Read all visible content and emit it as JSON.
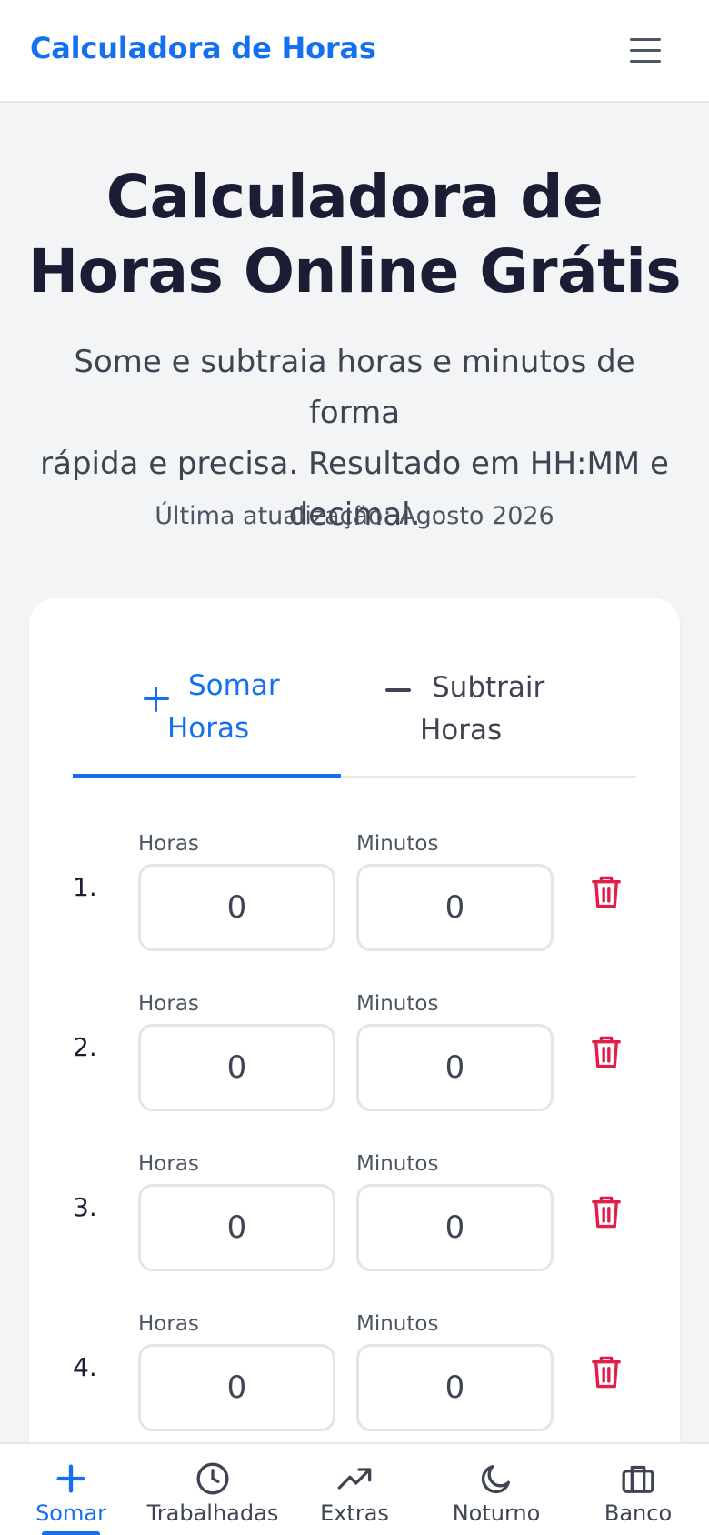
{
  "header": {
    "brand": "Calculadora de Horas",
    "menu_icon": "hamburger-menu-icon"
  },
  "hero": {
    "title_line1": "Calculadora de",
    "title_line2": "Horas Online Grátis",
    "subtitle_line1": "Some e subtraia horas e minutos de forma",
    "subtitle_line2": "rápida e precisa. Resultado em HH:MM e",
    "subtitle_line3": "decimal.",
    "updated": "Última atualização: Agosto 2026"
  },
  "tabs": {
    "add": {
      "line1": "Somar",
      "line2": "Horas",
      "icon": "plus-icon",
      "active": true
    },
    "subtract": {
      "line1": "Subtrair",
      "line2": "Horas",
      "icon": "minus-icon",
      "active": false
    }
  },
  "rows": [
    {
      "num": "1.",
      "hours_label": "Horas",
      "minutes_label": "Minutos",
      "hours": "0",
      "minutes": "0"
    },
    {
      "num": "2.",
      "hours_label": "Horas",
      "minutes_label": "Minutos",
      "hours": "0",
      "minutes": "0"
    },
    {
      "num": "3.",
      "hours_label": "Horas",
      "minutes_label": "Minutos",
      "hours": "0",
      "minutes": "0"
    },
    {
      "num": "4.",
      "hours_label": "Horas",
      "minutes_label": "Minutos",
      "hours": "0",
      "minutes": "0"
    }
  ],
  "bottom_nav": [
    {
      "label": "Somar",
      "icon": "plus-icon",
      "active": true
    },
    {
      "label": "Trabalhadas",
      "icon": "clock-icon",
      "active": false
    },
    {
      "label": "Extras",
      "icon": "trending-up-icon",
      "active": false
    },
    {
      "label": "Noturno",
      "icon": "moon-icon",
      "active": false
    },
    {
      "label": "Banco",
      "icon": "briefcase-icon",
      "active": false
    }
  ],
  "colors": {
    "accent": "#1570ef",
    "danger": "#e11d48",
    "text": "#1c1d35",
    "background": "#f3f4f6"
  }
}
